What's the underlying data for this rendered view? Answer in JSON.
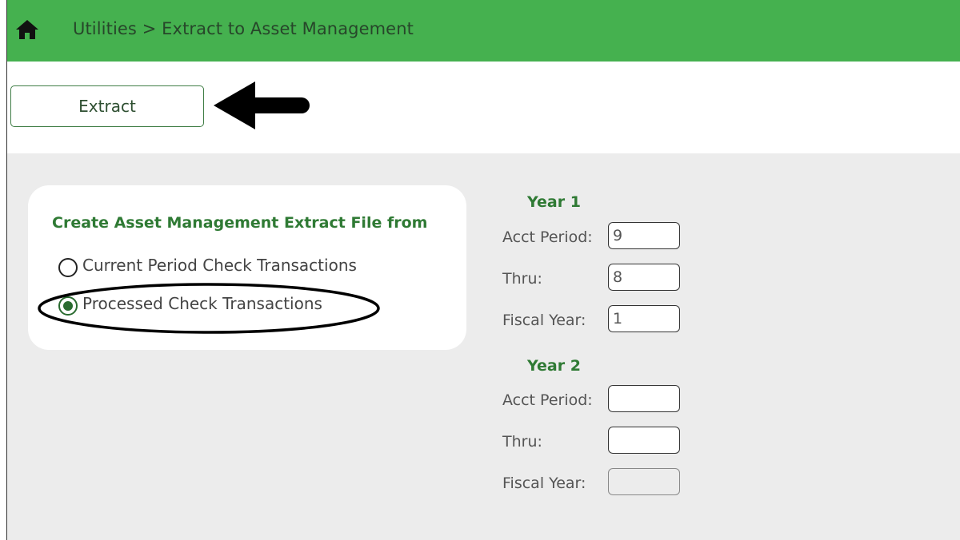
{
  "header": {
    "breadcrumb": "Utilities > Extract to Asset Management",
    "home_icon": "home-icon",
    "bg_color": "#45b14f"
  },
  "toolbar": {
    "extract_label": "Extract"
  },
  "options": {
    "title": "Create Asset Management Extract File from",
    "choices": [
      {
        "label": "Current Period Check Transactions",
        "selected": false
      },
      {
        "label": "Processed Check Transactions",
        "selected": true
      }
    ]
  },
  "year1": {
    "heading": "Year 1",
    "acct_period_label": "Acct Period:",
    "acct_period_value": "9",
    "thru_label": "Thru:",
    "thru_value": "8",
    "fiscal_year_label": "Fiscal Year:",
    "fiscal_year_value": "1"
  },
  "year2": {
    "heading": "Year 2",
    "acct_period_label": "Acct Period:",
    "acct_period_value": "",
    "thru_label": "Thru:",
    "thru_value": "",
    "fiscal_year_label": "Fiscal Year:",
    "fiscal_year_value": "",
    "fiscal_year_disabled": true
  },
  "colors": {
    "accent_green": "#2f7a34",
    "panel_bg": "#ececec"
  }
}
